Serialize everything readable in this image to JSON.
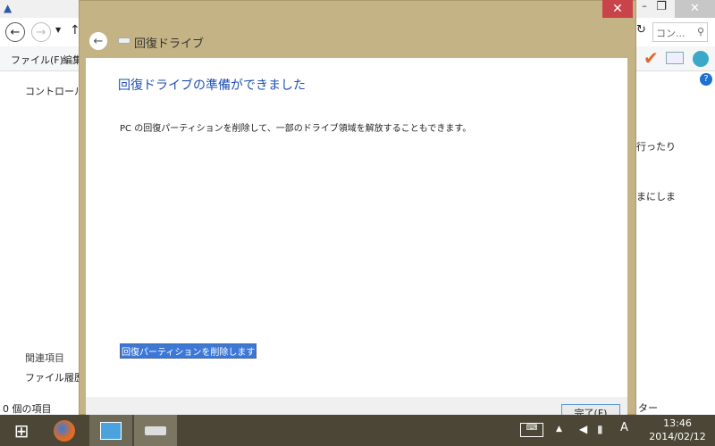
{
  "explorer": {
    "search_placeholder": "コン...",
    "menu_file": "ファイル(F)",
    "menu_edit": "編集",
    "breadcrumb": "コントロール パ",
    "related_heading": "関連項目",
    "related_link": "ファイル履歴",
    "status": "0 個の項目",
    "right_text_1": "行ったり",
    "right_text_2": "まにしま",
    "right_text_3": "ター"
  },
  "dialog": {
    "title": "回復ドライブ",
    "heading": "回復ドライブの準備ができました",
    "description": "PC の回復パーティションを削除して、一部のドライブ領域を解放することもできます。",
    "delete_link": "回復パーティションを削除します",
    "finish_button": "完了(F)"
  },
  "taskbar": {
    "time": "13:46",
    "date": "2014/02/12",
    "ime": "A"
  }
}
